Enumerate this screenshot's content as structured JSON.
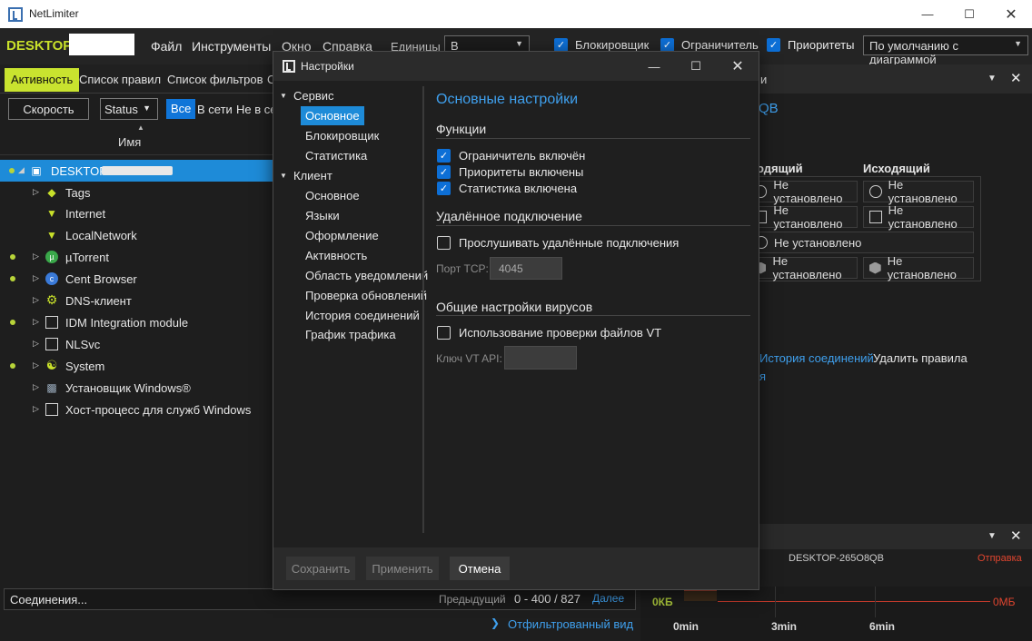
{
  "window": {
    "title": "NetLimiter"
  },
  "menubar": {
    "hostname": "DESKTOP-",
    "menu": [
      "Файл",
      "Инструменты",
      "Окно",
      "Справка"
    ],
    "units_label": "Единицы",
    "units_value": "B",
    "toggles": [
      {
        "label": "Блокировщик",
        "checked": true
      },
      {
        "label": "Ограничитель",
        "checked": true
      },
      {
        "label": "Приоритеты",
        "checked": true
      }
    ],
    "view_mode": "По умолчанию с диаграммой"
  },
  "tabs": [
    "Активность",
    "Список правил",
    "Список фильтров",
    "С"
  ],
  "filters": {
    "speed_button": "Скорость",
    "status_select": "Status",
    "all": "Все",
    "online": "В сети",
    "offline": "Не в се"
  },
  "tree": {
    "column_name": "Имя",
    "root": "DESKTOP-",
    "children": [
      "Tags",
      "Internet",
      "LocalNetwork"
    ],
    "apps": [
      "µTorrent",
      "Cent Browser",
      "DNS-клиент",
      "IDM Integration module",
      "NLSvc",
      "System",
      "Установщик Windows®",
      "Хост-процесс для служб Windows"
    ]
  },
  "right_panel": {
    "title_fragment": "и",
    "host_fragment": "QB",
    "incoming_header": "одящий",
    "outgoing_header": "Исходящий",
    "not_set": "Не установлено",
    "history_link": "История соединений",
    "delete_rules": "Удалить правила",
    "link_fragment": "я"
  },
  "chart_panel": {
    "host": "DESKTOP-265O8QB",
    "send_label": "Отправка",
    "y_left": "0КБ",
    "y_right": "0МБ",
    "x_ticks": [
      "0min",
      "3min",
      "6min"
    ]
  },
  "bottom": {
    "connections": "Соединения...",
    "previous": "Предыдущий",
    "range": "0 - 400 / 827",
    "next": "Далее",
    "filtered_view": "Отфильтрованный вид"
  },
  "dialog": {
    "title": "Настройки",
    "nav": {
      "service_group": "Сервис",
      "service_items": [
        "Основное",
        "Блокировщик",
        "Статистика"
      ],
      "client_group": "Клиент",
      "client_items": [
        "Основное",
        "Языки",
        "Оформление",
        "Активность",
        "Область уведомлений",
        "Проверка обновлений",
        "История соединений",
        "График трафика"
      ]
    },
    "heading": "Основные настройки",
    "functions_title": "Функции",
    "functions": [
      {
        "label": "Ограничитель включён",
        "checked": true
      },
      {
        "label": "Приоритеты включены",
        "checked": true
      },
      {
        "label": "Статистика включена",
        "checked": true
      }
    ],
    "remote_title": "Удалённое подключение",
    "remote_listen": "Прослушивать удалённые подключения",
    "tcp_port_label": "Порт TCP:",
    "tcp_port_value": "4045",
    "virus_title": "Общие настройки вирусов",
    "vt_check": "Использование проверки файлов VT",
    "vt_key_label": "Ключ VT API:",
    "buttons": {
      "save": "Сохранить",
      "apply": "Применить",
      "cancel": "Отмена"
    }
  }
}
